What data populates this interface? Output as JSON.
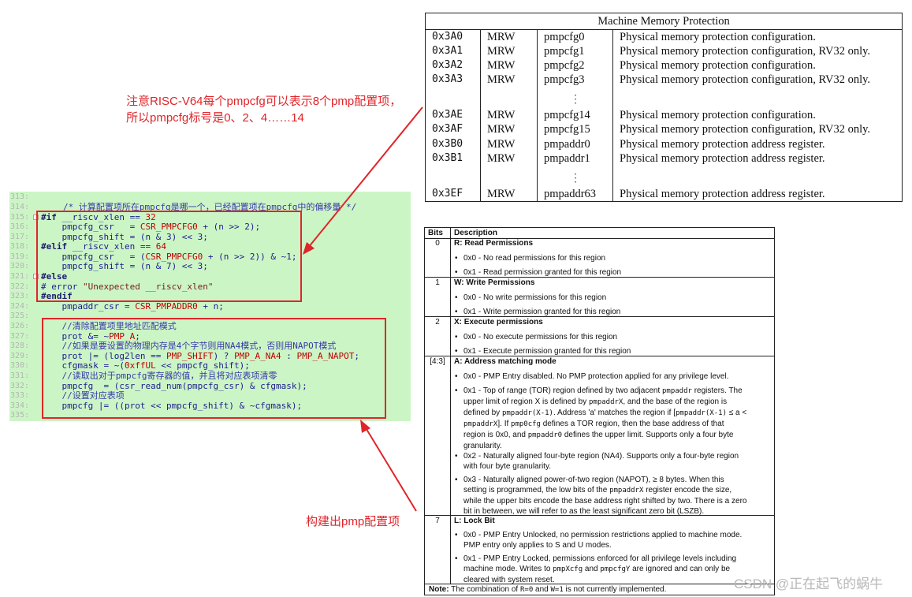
{
  "mmp_table": {
    "title": "Machine Memory Protection",
    "rows": [
      {
        "num": "0x3A0",
        "priv": "MRW",
        "name": "pmpcfg0",
        "desc": "Physical memory protection configuration."
      },
      {
        "num": "0x3A1",
        "priv": "MRW",
        "name": "pmpcfg1",
        "desc": "Physical memory protection configuration, RV32 only."
      },
      {
        "num": "0x3A2",
        "priv": "MRW",
        "name": "pmpcfg2",
        "desc": "Physical memory protection configuration."
      },
      {
        "num": "0x3A3",
        "priv": "MRW",
        "name": "pmpcfg3",
        "desc": "Physical memory protection configuration, RV32 only."
      },
      {
        "num": "0x3AE",
        "priv": "MRW",
        "name": "pmpcfg14",
        "desc": "Physical memory protection configuration."
      },
      {
        "num": "0x3AF",
        "priv": "MRW",
        "name": "pmpcfg15",
        "desc": "Physical memory protection configuration, RV32 only."
      },
      {
        "num": "0x3B0",
        "priv": "MRW",
        "name": "pmpaddr0",
        "desc": "Physical memory protection address register."
      },
      {
        "num": "0x3B1",
        "priv": "MRW",
        "name": "pmpaddr1",
        "desc": "Physical memory protection address register."
      },
      {
        "num": "0x3EF",
        "priv": "MRW",
        "name": "pmpaddr63",
        "desc": "Physical memory protection address register."
      }
    ]
  },
  "annotations": {
    "top_line1": "注意RISC-V64每个pmpcfg可以表示8个pmp配置项，",
    "top_line2": "所以pmpcfg标号是0、2、4……14",
    "bottom": "构建出pmp配置项"
  },
  "code": {
    "line_numbers": [
      "313:",
      "314:",
      "315:",
      "316:",
      "317:",
      "318:",
      "319:",
      "320:",
      "321:",
      "322:",
      "323:",
      "324:",
      "325:",
      "326:",
      "327:",
      "328:",
      "329:",
      "330:",
      "331:",
      "332:",
      "333:",
      "334:",
      "335:"
    ],
    "l314_comment": "/* 计算配置项所在pmpcfg是哪一个，已经配置项在pmpcfg中的偏移量 */",
    "l315_kw": "#if",
    "l315_rest": " __riscv_xlen == ",
    "l315_num": "32",
    "l316_a": "    pmpcfg_csr   = ",
    "l316_b": "CSR_PMPCFG0",
    "l316_c": " + (n >> 2);",
    "l317_a": "    pmpcfg_shift = (n & 3) << 3;",
    "l318_kw": "#elif",
    "l318_rest": " __riscv_xlen == ",
    "l318_num": "64",
    "l319_a": "    pmpcfg_csr   = (",
    "l319_b": "CSR_PMPCFG0",
    "l319_c": " + (n >> 2)) & ~1;",
    "l320_a": "    pmpcfg_shift = (n & 7) << 3;",
    "l321_kw": "#else",
    "l322_a": "# error ",
    "l322_str": "\"Unexpected __riscv_xlen\"",
    "l323_kw": "#endif",
    "l324_a": "    pmpaddr_csr = ",
    "l324_b": "CSR_PMPADDR0",
    "l324_c": " + n;",
    "l326_cm": "    //清除配置项里地址匹配模式",
    "l327_a": "    prot &= ~",
    "l327_b": "PMP_A",
    "l327_c": ";",
    "l328_cm": "    //如果是要设置的物理内存是4个字节则用NA4模式，否则用NAPOT模式",
    "l329_a": "    prot |= (log2len == ",
    "l329_b": "PMP_SHIFT",
    "l329_c": ") ? ",
    "l329_d": "PMP_A_NA4",
    "l329_e": " : ",
    "l329_f": "PMP_A_NAPOT",
    "l329_g": ";",
    "l330_a": "    cfgmask = ~(",
    "l330_b": "0xffUL",
    "l330_c": " << pmpcfg_shift);",
    "l331_cm": "    //读取出对于pmpcfg寄存器的值，并且将对应表项清零",
    "l332_a": "    pmpcfg  = (csr_read_num(pmpcfg_csr) & cfgmask);",
    "l333_cm": "    //设置对应表项",
    "l334_a": "    pmpcfg |= ((prot << pmpcfg_shift) & ~cfgmask);"
  },
  "bits_table": {
    "header_bits": "Bits",
    "header_desc": "Description",
    "r0_bits": "0",
    "r0_title": "R: Read Permissions",
    "r0_i1": "0x0 - No read permissions for this region",
    "r0_i2": "0x1 - Read permission granted for this region",
    "r1_bits": "1",
    "r1_title": "W: Write Permissions",
    "r1_i1": "0x0 - No write permissions for this region",
    "r1_i2": "0x1 - Write permission granted for this region",
    "r2_bits": "2",
    "r2_title": "X: Execute permissions",
    "r2_i1": "0x0 - No execute permissions for this region",
    "r2_i2": "0x1 - Execute permission granted for this region",
    "r3_bits": "[4:3]",
    "r3_title": "A: Address matching mode",
    "r3_i1": "0x0 - PMP Entry disabled. No PMP protection applied for any privilege level.",
    "tor_1": "0x1 - Top of range (TOR) region defined by two adjacent ",
    "tor_1m": "pmpaddr",
    "tor_1e": " registers. The",
    "tor_2": "upper limit of region X is defined by ",
    "tor_2m": "pmpaddrX",
    "tor_2e": ", and the base of the region is",
    "tor_3": "defined by ",
    "tor_3m": "pmpaddr(X-1)",
    "tor_3e": ". Address 'a' matches the region if [",
    "tor_3m2": "pmpaddr(X-1)",
    "tor_3e2": " ≤ a <",
    "tor_4m": "pmpaddrX",
    "tor_4e": "]. If ",
    "tor_4m2": "pmp0cfg",
    "tor_4e2": " defines a TOR region, then the base address of that",
    "tor_5": "region is 0x0, and ",
    "tor_5m": "pmpaddr0",
    "tor_5e": " defines the upper limit. Supports only a four byte",
    "tor_6": "granularity.",
    "na4_1": "0x2 - Naturally aligned four-byte region (NA4). Supports only a four-byte region",
    "na4_2": "with four byte granularity.",
    "napot_1": "0x3 - Naturally aligned power-of-two region (NAPOT), ≥ 8 bytes. When this",
    "napot_2": "setting is programmed, the low bits of the ",
    "napot_2m": "pmpaddrX",
    "napot_2e": " register encode the size,",
    "napot_3": "while the upper bits encode the base address right shifted by two. There is a zero",
    "napot_4": "bit in between, we will refer to as the least significant zero bit (LSZB).",
    "r4_bits": "7",
    "r4_title": "L: Lock Bit",
    "lock0_1": "0x0 - PMP Entry Unlocked, no permission restrictions applied to machine mode.",
    "lock0_2": "PMP entry only applies to S and U modes.",
    "lock1_1": "0x1 - PMP Entry Locked, permissions enforced for all privilege levels including",
    "lock1_2": "machine mode. Writes to ",
    "lock1_2m": "pmpXcfg",
    "lock1_2e": " and ",
    "lock1_2m2": "pmpcfgY",
    "lock1_2e2": " are ignored and can only be",
    "lock1_3": "cleared with system reset.",
    "note_label": "Note:",
    "note_a": " The combination of ",
    "note_m1": "R=0",
    "note_b": " and ",
    "note_m2": "W=1",
    "note_c": " is not currently implemented."
  },
  "watermark": "CSDN @正在起飞的蜗牛",
  "colors": {
    "annotation_red": "#e0252a",
    "code_bg": "#ccf5c6"
  }
}
